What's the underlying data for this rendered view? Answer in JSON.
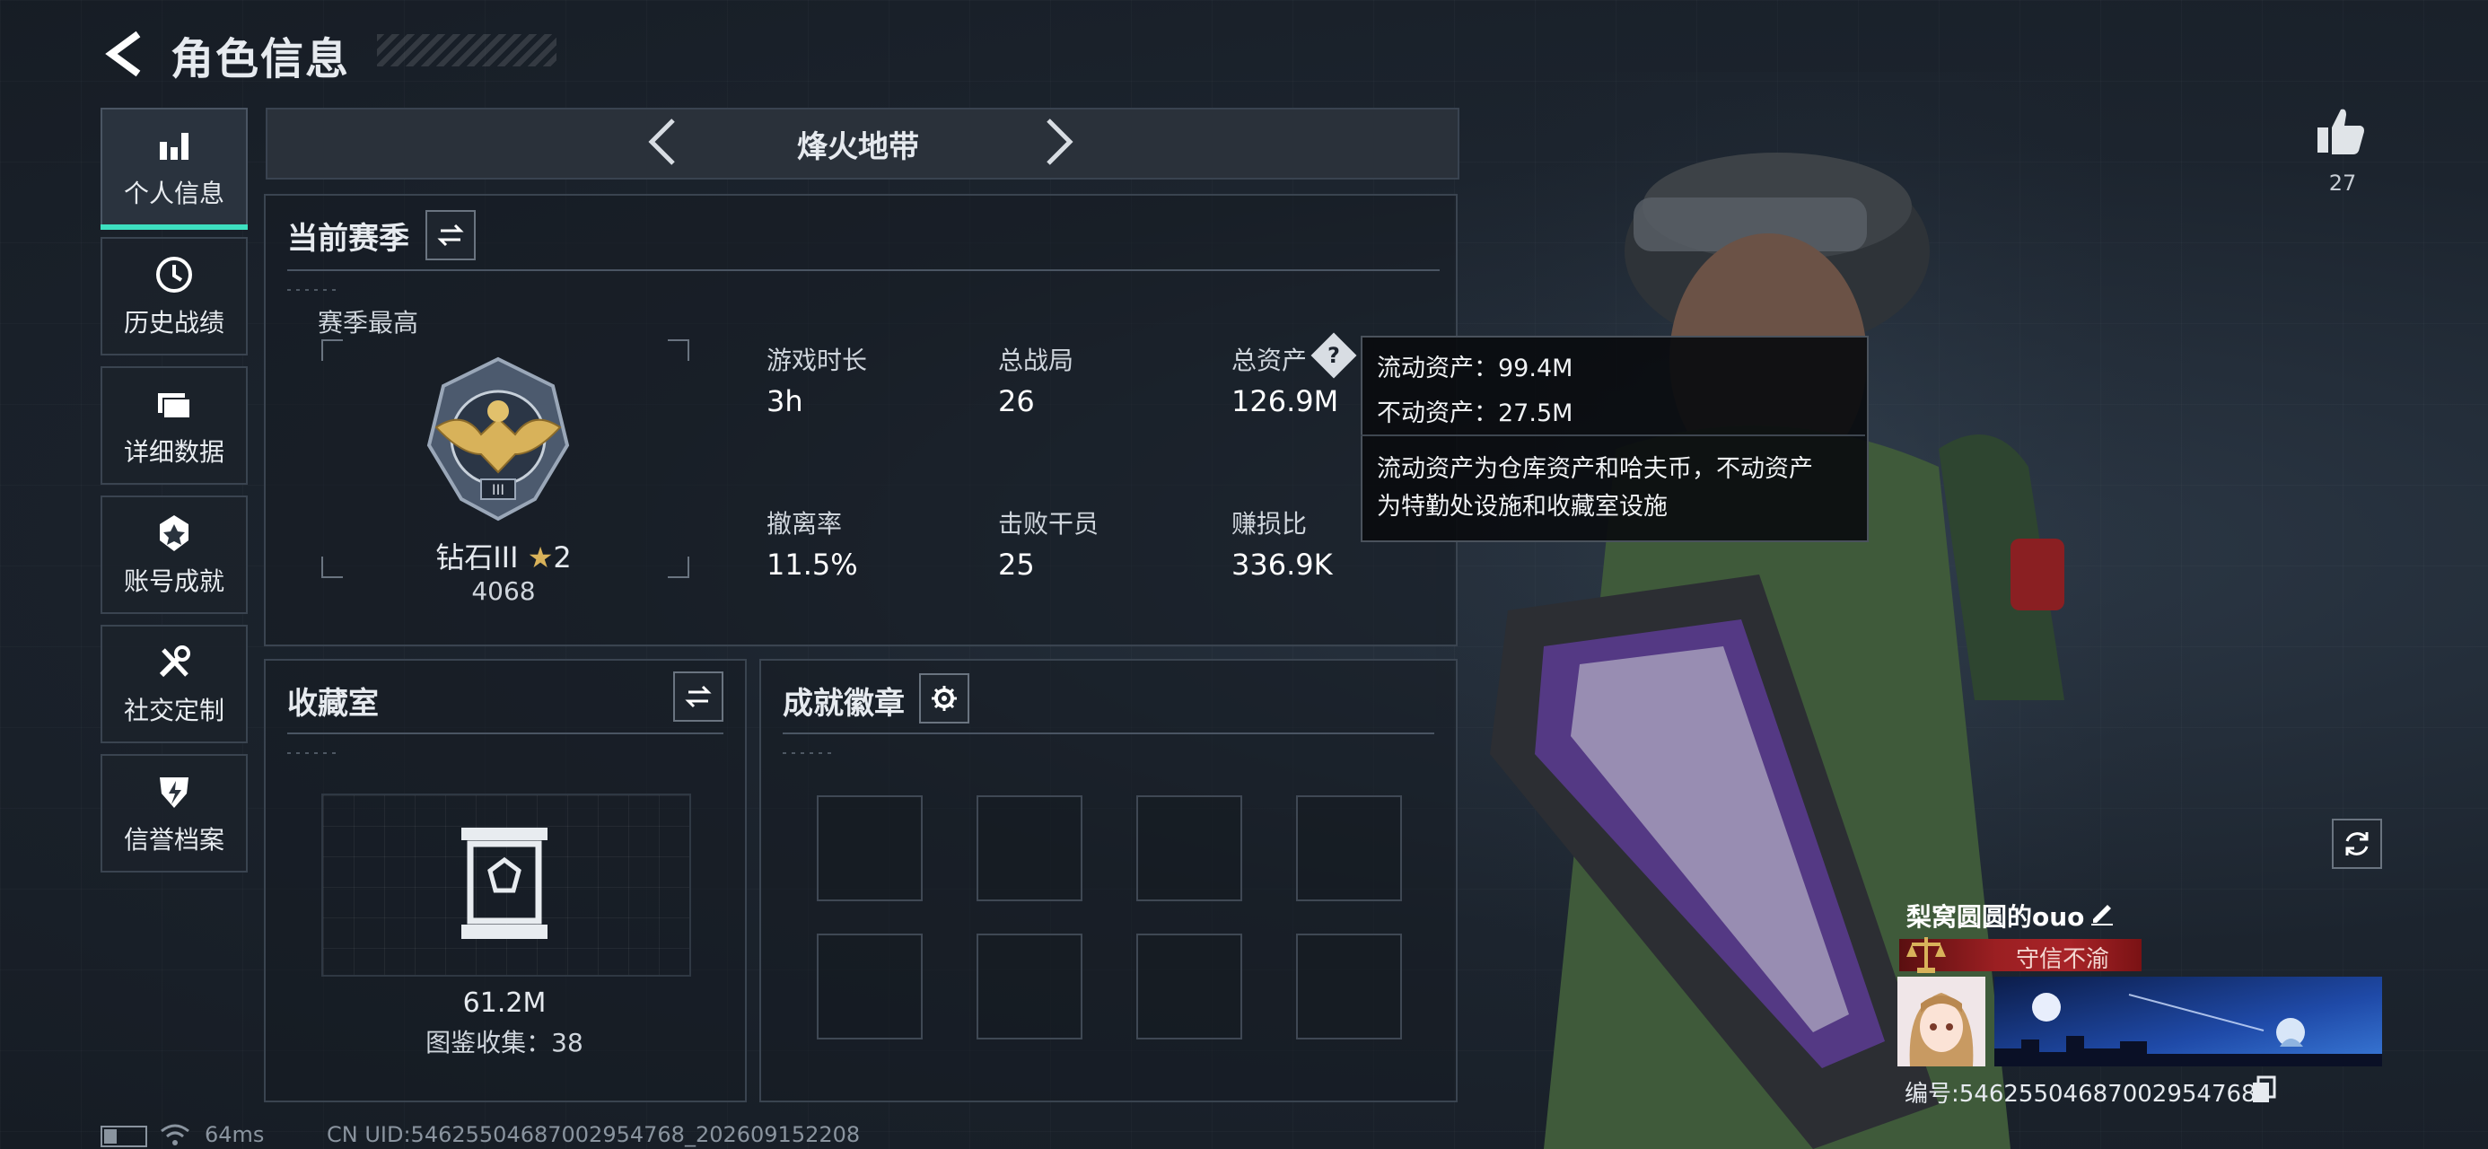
{
  "page": {
    "title": "角色信息"
  },
  "sidebar": {
    "items": [
      {
        "label": "个人信息",
        "icon": "bar-chart-icon",
        "active": true
      },
      {
        "label": "历史战绩",
        "icon": "clock-icon",
        "active": false
      },
      {
        "label": "详细数据",
        "icon": "folder-icon",
        "active": false
      },
      {
        "label": "账号成就",
        "icon": "medal-icon",
        "active": false
      },
      {
        "label": "社交定制",
        "icon": "tools-icon",
        "active": false
      },
      {
        "label": "信誉档案",
        "icon": "shield-bolt-icon",
        "active": false
      }
    ]
  },
  "mode": {
    "name": "烽火地带"
  },
  "season": {
    "title": "当前赛季",
    "best_label": "赛季最高",
    "rank_name": "钻石III",
    "rank_stars": "2",
    "rank_score": "4068",
    "stats": [
      {
        "label": "游戏时长",
        "value": "3h"
      },
      {
        "label": "总战局",
        "value": "26"
      },
      {
        "label": "总资产",
        "value": "126.9M"
      },
      {
        "label": "撤离率",
        "value": "11.5%"
      },
      {
        "label": "击败干员",
        "value": "25"
      },
      {
        "label": "赚损比",
        "value": "336.9K"
      }
    ]
  },
  "tooltip": {
    "line1": "流动资产：99.4M",
    "line2": "不动资产：27.5M",
    "line3": "流动资产为仓库资产和哈夫币，不动资产",
    "line4": "为特勤处设施和收藏室设施"
  },
  "collection": {
    "title": "收藏室",
    "value": "61.2M",
    "catalog": "图鉴收集：38"
  },
  "badges": {
    "title": "成就徽章",
    "slots": 8
  },
  "profile": {
    "likes": "27",
    "nickname": "梨窝圆圆的ouo",
    "title_text": "守信不渝",
    "uid_line": "编号:5462550468700295476​8"
  },
  "status": {
    "ping": "64ms",
    "uid": "CN UID:5462550468700295476​8_202609152208"
  },
  "colors": {
    "accent": "#3de0c0",
    "tooltip_bg": "#0a0c0f",
    "title_red": "#a82428",
    "star": "#d8b25a"
  }
}
